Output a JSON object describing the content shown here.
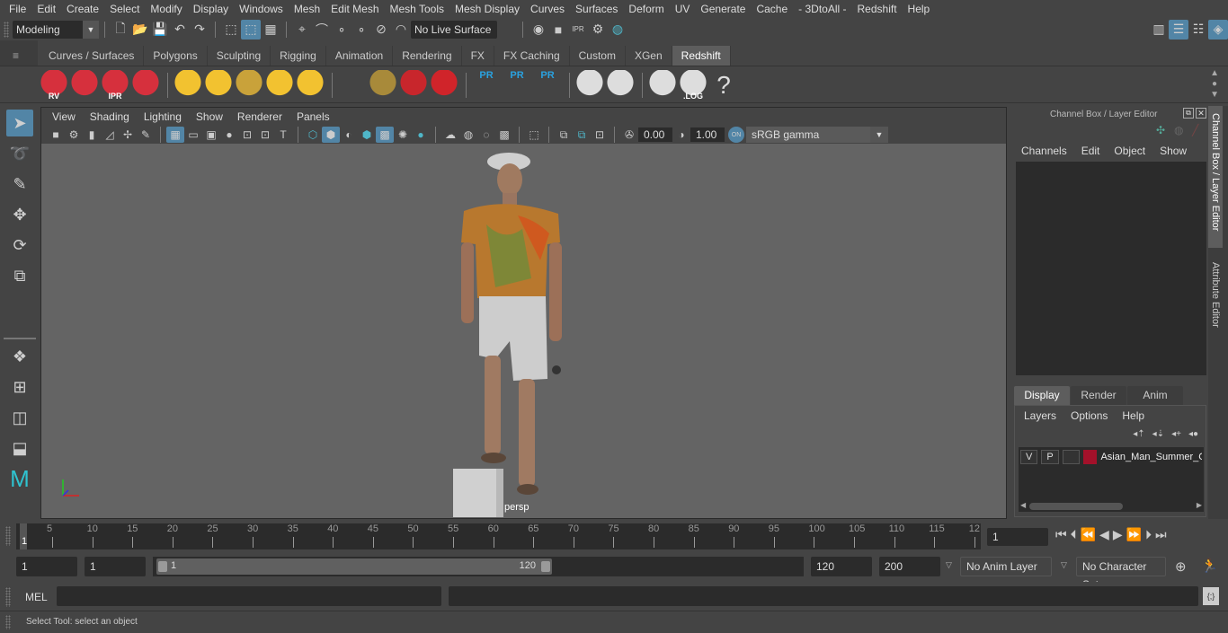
{
  "menubar": [
    "File",
    "Edit",
    "Create",
    "Select",
    "Modify",
    "Display",
    "Windows",
    "Mesh",
    "Edit Mesh",
    "Mesh Tools",
    "Mesh Display",
    "Curves",
    "Surfaces",
    "Deform",
    "UV",
    "Generate",
    "Cache",
    "- 3DtoAll -",
    "Redshift",
    "Help"
  ],
  "status_line": {
    "mode_selector": "Modeling",
    "live_surface": "No Live Surface"
  },
  "shelf": {
    "tabs": [
      "Curves / Surfaces",
      "Polygons",
      "Sculpting",
      "Rigging",
      "Animation",
      "Rendering",
      "FX",
      "FX Caching",
      "Custom",
      "XGen",
      "Redshift"
    ],
    "active_tab": "Redshift",
    "icons": [
      {
        "name": "rs-render-view-icon",
        "label": "RV"
      },
      {
        "name": "rs-render-sequence-icon",
        "label": ""
      },
      {
        "name": "rs-ipr-icon",
        "label": "IPR"
      },
      {
        "name": "rs-render-settings-icon",
        "label": ""
      },
      {
        "name": "rs-area-light-icon",
        "label": ""
      },
      {
        "name": "rs-portal-light-icon",
        "label": ""
      },
      {
        "name": "rs-spot-light-icon",
        "label": ""
      },
      {
        "name": "rs-dome-light-icon",
        "label": ""
      },
      {
        "name": "rs-sun-sky-icon",
        "label": ""
      },
      {
        "name": "rs-proxy-icon",
        "label": ""
      },
      {
        "name": "rs-hair-icon",
        "label": ""
      },
      {
        "name": "rs-volume-icon",
        "label": ""
      },
      {
        "name": "rs-sphere-icon",
        "label": ""
      },
      {
        "name": "rs-pr-mesh-icon",
        "label": "PR"
      },
      {
        "name": "rs-pr-export-icon",
        "label": "PR"
      },
      {
        "name": "rs-pr-swap-icon",
        "label": "PR"
      },
      {
        "name": "rs-bake-icon",
        "label": ""
      },
      {
        "name": "rs-bake-set-icon",
        "label": ""
      },
      {
        "name": "rs-script-icon",
        "label": ""
      },
      {
        "name": "rs-log-icon",
        "label": ".LOG"
      },
      {
        "name": "help-icon",
        "label": "?"
      }
    ]
  },
  "viewport": {
    "menu": [
      "View",
      "Shading",
      "Lighting",
      "Show",
      "Renderer",
      "Panels"
    ],
    "exposure": "0.00",
    "gamma": "1.00",
    "color_mgmt_toggle": "ON",
    "view_transform": "sRGB gamma",
    "camera_label": "persp"
  },
  "channel_box": {
    "title": "Channel Box / Layer Editor",
    "menu": [
      "Channels",
      "Edit",
      "Object",
      "Show"
    ]
  },
  "layer_editor": {
    "tabs": [
      "Display",
      "Render",
      "Anim"
    ],
    "active_tab": "Display",
    "menu": [
      "Layers",
      "Options",
      "Help"
    ],
    "layers": [
      {
        "visible": "V",
        "playback": "P",
        "color": "#a3112a",
        "name": "Asian_Man_Summer_C"
      }
    ]
  },
  "side_tabs": [
    "Channel Box / Layer Editor",
    "Attribute Editor"
  ],
  "timeline": {
    "ticks": [
      "5",
      "10",
      "15",
      "20",
      "25",
      "30",
      "35",
      "40",
      "45",
      "50",
      "55",
      "60",
      "65",
      "70",
      "75",
      "80",
      "85",
      "90",
      "95",
      "100",
      "105",
      "110",
      "115",
      "12"
    ],
    "current_frame_marker": "1",
    "current_frame": "1"
  },
  "range": {
    "start_time": "1",
    "playback_start": "1",
    "slider_start": "1",
    "slider_end": "120",
    "playback_end": "120",
    "end_time": "200",
    "anim_layer": "No Anim Layer",
    "character_set": "No Character Set"
  },
  "command_line": {
    "language": "MEL",
    "input": "",
    "result": ""
  },
  "help_line": "Select Tool: select an object"
}
